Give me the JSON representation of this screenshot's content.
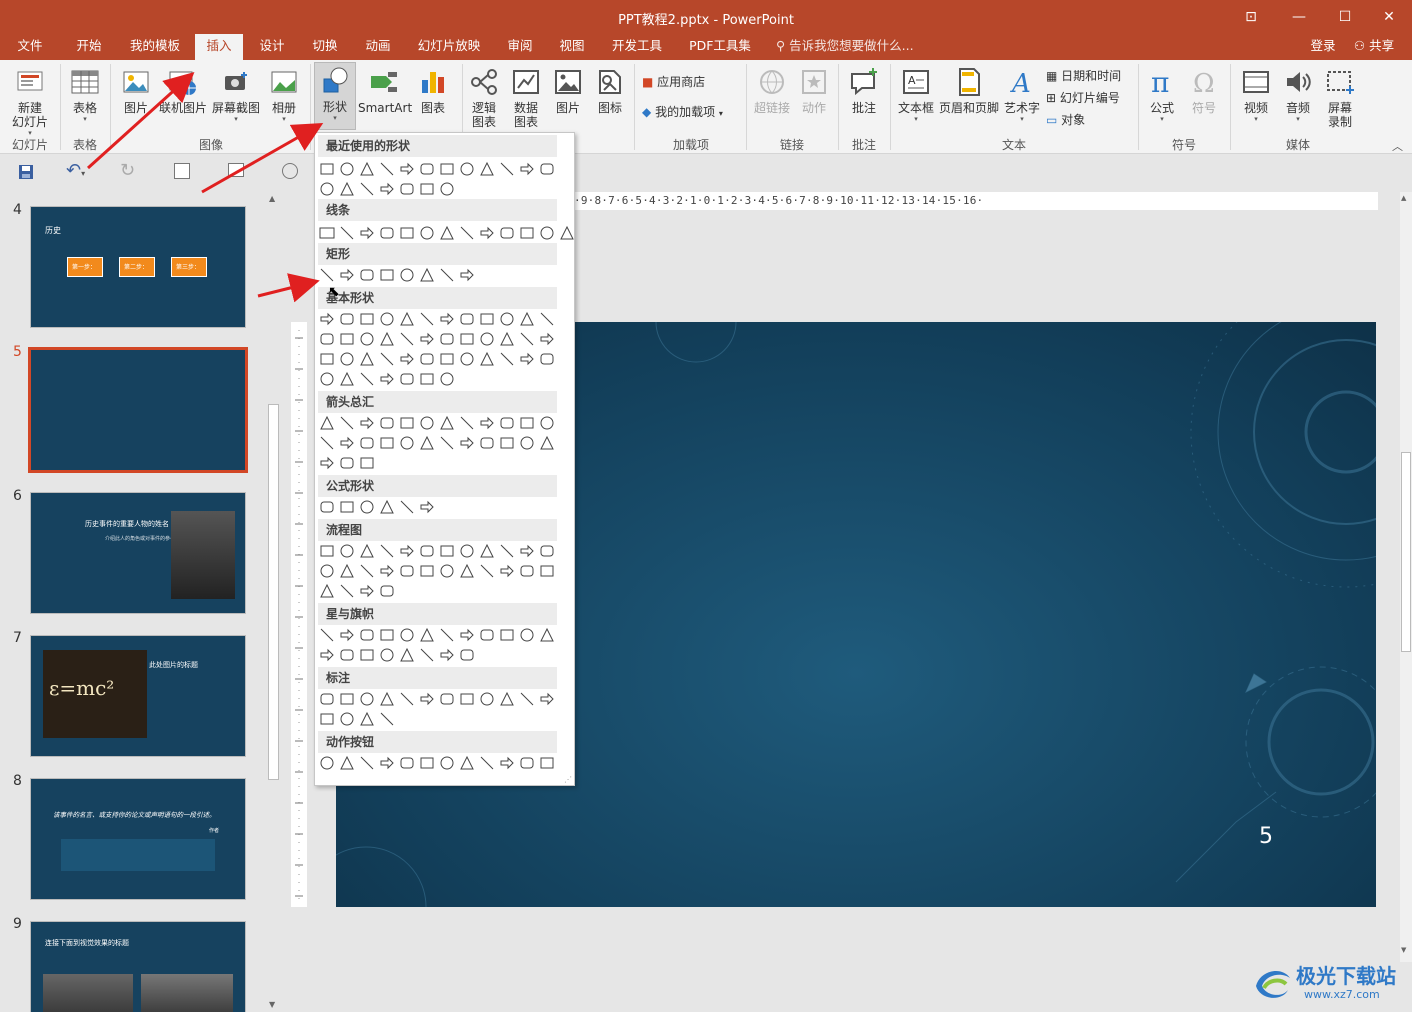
{
  "window": {
    "title": "PPT教程2.pptx - PowerPoint"
  },
  "menu": {
    "tabs": [
      "文件",
      "开始",
      "我的模板",
      "插入",
      "设计",
      "切换",
      "动画",
      "幻灯片放映",
      "审阅",
      "视图",
      "开发工具",
      "PDF工具集"
    ],
    "tell_me": "告诉我您想要做什么...",
    "login": "登录",
    "share": "共享"
  },
  "ribbon": {
    "slides": {
      "new_slide": "新建",
      "new_slide2": "幻灯片",
      "group": "幻灯片"
    },
    "tables": {
      "table": "表格",
      "group": "表格"
    },
    "images": {
      "picture": "图片",
      "online_picture": "联机图片",
      "screenshot": "屏幕截图",
      "album": "相册",
      "group": "图像"
    },
    "illustrations": {
      "shapes": "形状",
      "smartart": "SmartArt",
      "chart": "图表"
    },
    "extra": {
      "logic_chart": "逻辑",
      "logic_chart2": "图表",
      "data_chart": "数据",
      "data_chart2": "图表",
      "picture2": "图片",
      "icon": "图标"
    },
    "addins": {
      "store": "应用商店",
      "my_addins": "我的加载项",
      "group": "加载项"
    },
    "links": {
      "hyperlink": "超链接",
      "action": "动作",
      "group": "链接"
    },
    "comments": {
      "comment": "批注",
      "group": "批注"
    },
    "text": {
      "textbox": "文本框",
      "header_footer": "页眉和页脚",
      "wordart": "艺术字",
      "datetime": "日期和时间",
      "slide_number": "幻灯片编号",
      "object": "对象",
      "group": "文本"
    },
    "symbols": {
      "equation": "公式",
      "symbol": "符号",
      "group": "符号"
    },
    "media": {
      "video": "视频",
      "audio": "音频",
      "screen_record": "屏幕",
      "screen_record2": "录制",
      "group": "媒体"
    }
  },
  "shapes_gallery": {
    "headers": [
      "最近使用的形状",
      "线条",
      "矩形",
      "基本形状",
      "箭头总汇",
      "公式形状",
      "流程图",
      "星与旗帜",
      "标注",
      "动作按钮"
    ]
  },
  "thumbnails": [
    {
      "num": "4",
      "title": "历史",
      "steps": [
        "第一步：",
        "第二步：",
        "第三步："
      ]
    },
    {
      "num": "5"
    },
    {
      "num": "6",
      "title": "历史事件的重要人物的姓名",
      "sub": "介绍此人的角色或对事件的参与。"
    },
    {
      "num": "7",
      "title": "此处图片的标题",
      "formula": "ε=mc²"
    },
    {
      "num": "8",
      "quote": "该事件的名言、或支持你的论文或声明语句的一段引述。",
      "author": "作者"
    },
    {
      "num": "9",
      "title": "连接下面到视觉效果的标题"
    }
  ],
  "ruler": {
    "text": "·9·8·7·6·5·4·3·2·1·0·1·2·3·4·5·6·7·8·9·10·11·12·13·14·15·16·"
  },
  "slide": {
    "number": "5"
  },
  "watermark": {
    "text": "极光下载站",
    "url": "www.xz7.com"
  }
}
